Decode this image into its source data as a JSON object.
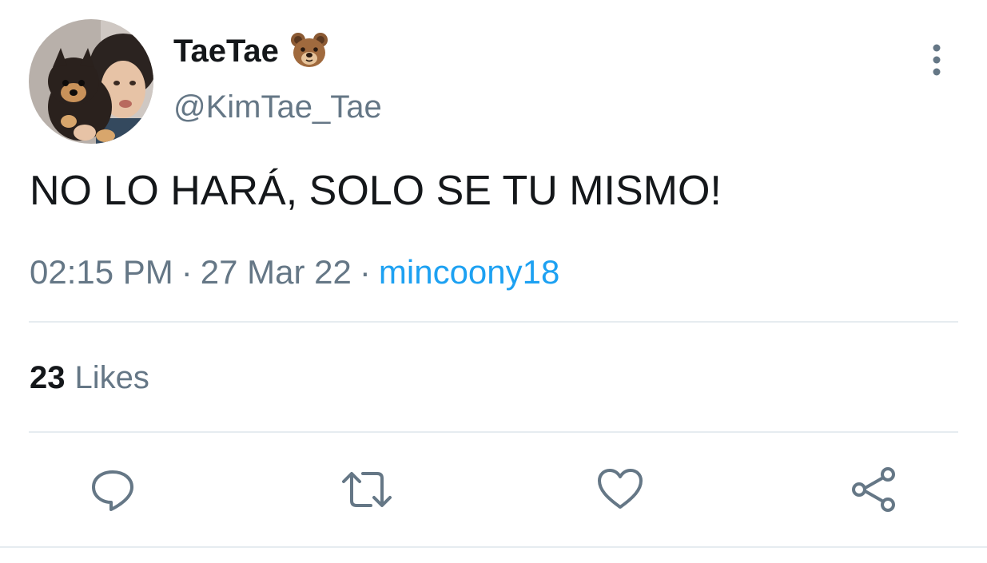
{
  "tweet": {
    "display_name": "TaeTae",
    "handle": "@KimTae_Tae",
    "text": "NO LO HARÁ, SOLO SE TU MISMO!",
    "time": "02:15 PM",
    "date": "27 Mar 22",
    "via": "mincoony18",
    "likes_count": "23",
    "likes_label": "Likes"
  },
  "icons": {
    "name_emoji": "bear-face-icon",
    "more": "more-vertical-icon",
    "reply": "reply-icon",
    "retweet": "retweet-icon",
    "like": "heart-icon",
    "share": "share-icon"
  },
  "colors": {
    "text": "#14171a",
    "secondary": "#657786",
    "link": "#1da1f2",
    "divider": "#e6ecf0"
  }
}
